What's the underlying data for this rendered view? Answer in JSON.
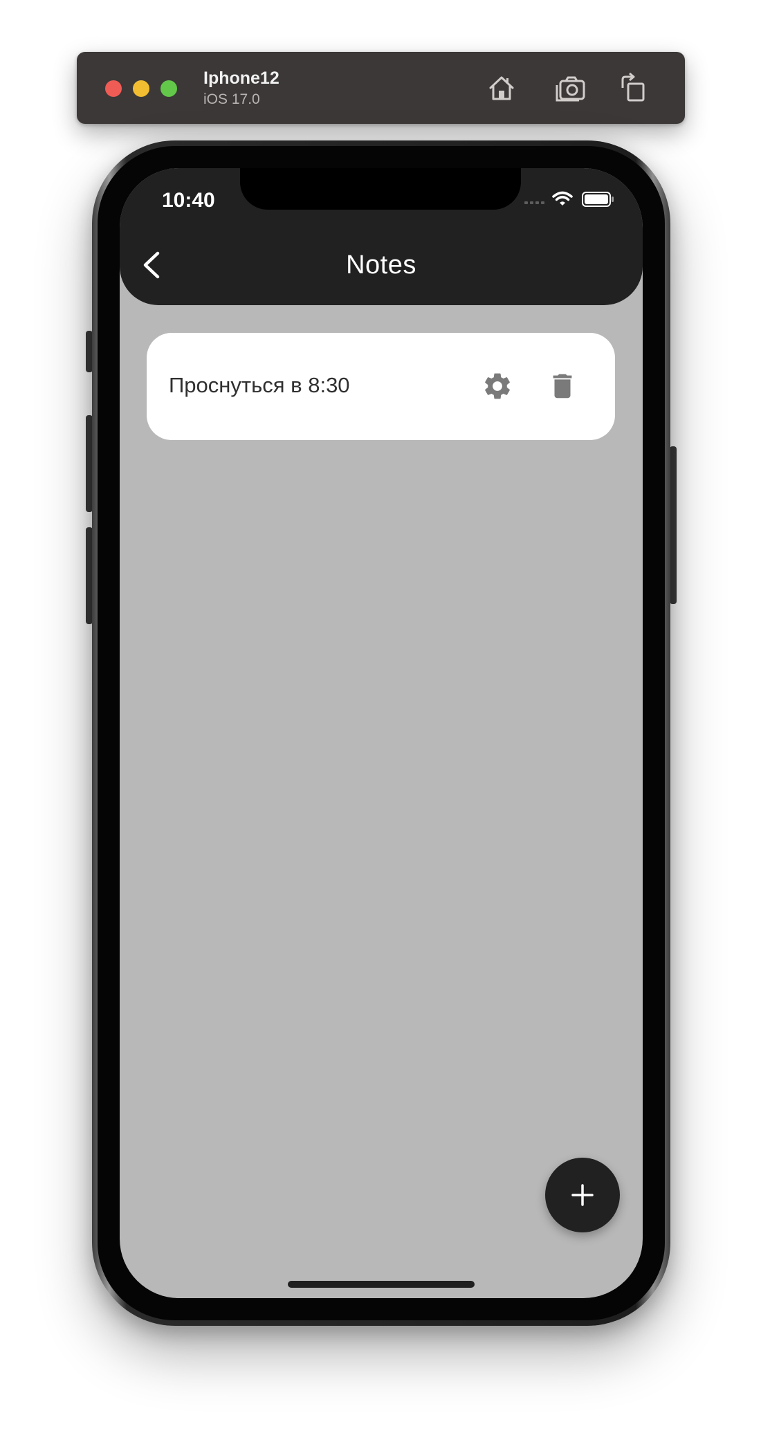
{
  "simulator": {
    "device_name": "Iphone12",
    "os_version": "iOS 17.0",
    "icons": [
      "home-icon",
      "screenshot-icon",
      "rotate-icon"
    ]
  },
  "status_bar": {
    "time": "10:40",
    "icons": [
      "cellular-icon",
      "wifi-icon",
      "battery-icon"
    ]
  },
  "app_bar": {
    "title": "Notes",
    "back_icon": "chevron-left-icon",
    "background": "#212121"
  },
  "notes": [
    {
      "text": "Проснуться в 8:30",
      "edit_icon": "gear-icon",
      "delete_icon": "trash-icon"
    }
  ],
  "fab": {
    "icon": "plus-icon",
    "background": "#212121"
  },
  "colors": {
    "screen_background": "#b8b8b8",
    "card_background": "#ffffff",
    "icon_gray": "#7a7a7a"
  }
}
